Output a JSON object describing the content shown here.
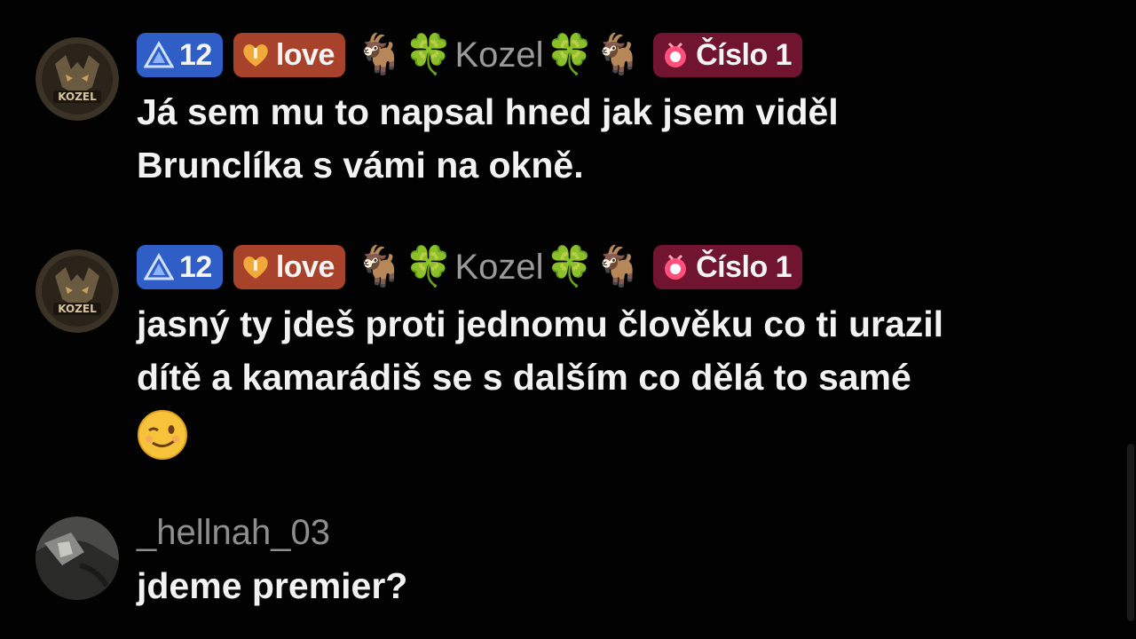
{
  "messages": [
    {
      "avatar": "kozel-avatar",
      "badges": {
        "level": "12",
        "love": "love",
        "nick_left": "🐐🍀",
        "nick": "Kozel",
        "nick_right": "🍀🐐",
        "cislo": "Číslo 1"
      },
      "text_line1": "Já sem mu to napsal hned jak jsem viděl",
      "text_line2": "Brunclíka s vámi na okně."
    },
    {
      "avatar": "kozel-avatar",
      "badges": {
        "level": "12",
        "love": "love",
        "nick_left": "🐐🍀",
        "nick": "Kozel",
        "nick_right": "🍀🐐",
        "cislo": "Číslo 1"
      },
      "text_line1": "jasný ty jdeš proti jednomu člověku co ti urazil",
      "text_line2": "dítě a kamarádiš se s dalším co dělá to samé",
      "emoji": "😉"
    },
    {
      "avatar": "user-avatar",
      "username": "_hellnah_03",
      "text_line1": "jdeme premier?"
    }
  ],
  "colors": {
    "level_badge": "#2e5ec6",
    "love_badge": "#a9422a",
    "cislo_badge": "#71142f",
    "text": "#f2f2f2",
    "username": "#8e8e8e"
  }
}
